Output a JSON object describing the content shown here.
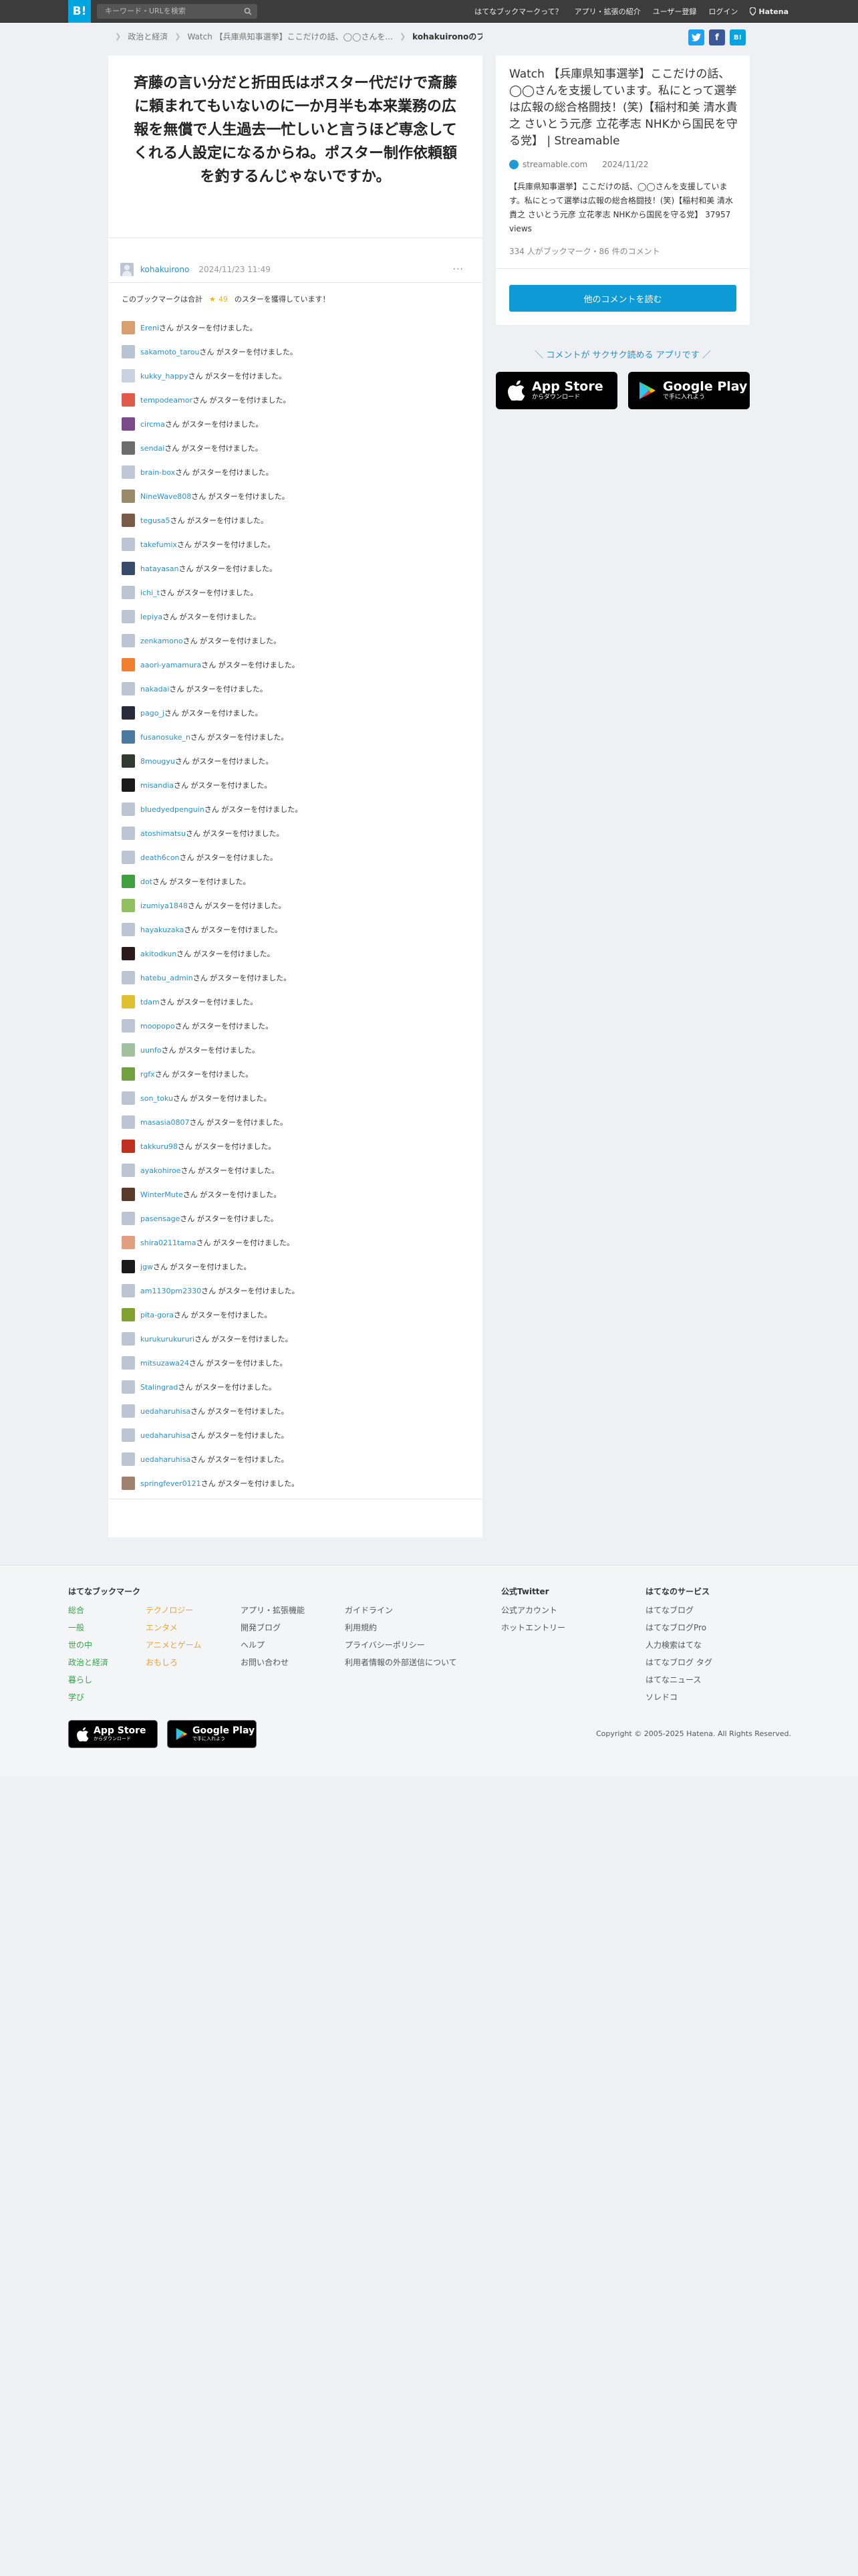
{
  "topbar": {
    "logo": "B!",
    "search_placeholder": "キーワード・URLを検索",
    "nav": [
      "はてなブックマークって？",
      "アプリ・拡張の紹介",
      "ユーザー登録",
      "ログイン"
    ],
    "brand": "Hatena"
  },
  "breadcrumb": {
    "items": [
      "政治と経済",
      "Watch 【兵庫県知事選挙】ここだけの話、◯◯さんを...",
      "kohakuironoのブック..."
    ]
  },
  "share": {
    "twitter": "t",
    "facebook": "f",
    "hatebu": "B!"
  },
  "colors": {
    "accent": "#00a4de",
    "link": "#2c8fc8",
    "star": "#f2b705",
    "twitter": "#1da1f2",
    "facebook": "#3b5998"
  },
  "bookmark": {
    "comment": "斉藤の言い分だと折田氏はポスター代だけで斎藤に頼まれてもいないのに一か月半も本来業務の広報を無償で人生過去一忙しいと言うほど専念してくれる人設定になるからね。ポスター制作依頼額を釣するんじゃないですか。",
    "user": "kohakuirono",
    "date": "2024/11/23 11:49",
    "more": "···"
  },
  "stars": {
    "prefix": "このブックマークは合計",
    "star_glyph": "★",
    "count": "49",
    "suffix": "のスターを獲得しています！",
    "line_suffix": "さん がスターを付けました。",
    "users": [
      "Ereni",
      "sakamoto_tarou",
      "kukky_happy",
      "tempodeamor",
      "circma",
      "sendai",
      "brain-box",
      "NineWave808",
      "tegusa5",
      "takefumix",
      "hatayasan",
      "ichi_t",
      "lepiya",
      "zenkamono",
      "aaori-yamamura",
      "nakadai",
      "pago_j",
      "fusanosuke_n",
      "8mougyu",
      "misandia",
      "bluedyedpenguin",
      "atoshimatsu",
      "death6con",
      "dot",
      "izumiya1848",
      "hayakuzaka",
      "akitodkun",
      "hatebu_admin",
      "tdam",
      "moopopo",
      "uunfo",
      "rgfx",
      "son_toku",
      "masasia0807",
      "takkuru98",
      "ayakohiroe",
      "WinterMute",
      "pasensage",
      "shira0211tama",
      "jgw",
      "am1130pm2330",
      "pita-gora",
      "kurukurukururi",
      "mitsuzawa24",
      "Stalingrad",
      "uedaharuhisa",
      "uedaharuhisa",
      "uedaharuhisa",
      "springfever0121"
    ],
    "avatar_colors": [
      "#d8a070",
      "#b8c4d4",
      "#c9d2de",
      "#e05a4a",
      "#7a4a8a",
      "#6c6c6c",
      "#c0c8d6",
      "#9a8a6a",
      "#7a5a4a",
      "#bcc6d3",
      "#3a4a6a",
      "#bcc6d3",
      "#bcc6d3",
      "#bcc6d3",
      "#f08030",
      "#bcc6d3",
      "#2a2a3a",
      "#4a7aa0",
      "#303a30",
      "#1a1a1a",
      "#bcc6d3",
      "#bcc6d3",
      "#bcc6d3",
      "#40a040",
      "#90c060",
      "#bcc6d3",
      "#2a1a1a",
      "#bcc6d3",
      "#e0c030",
      "#bcc6d3",
      "#a0c0a0",
      "#70a040",
      "#bcc6d3",
      "#bcc6d3",
      "#c03020",
      "#bcc6d3",
      "#5a3a2a",
      "#bcc6d3",
      "#e0a080",
      "#1a1a1a",
      "#bcc6d3",
      "#80a030",
      "#bcc6d3",
      "#bcc6d3",
      "#bcc6d3",
      "#bcc6d3",
      "#bcc6d3",
      "#bcc6d3",
      "#a08070"
    ]
  },
  "entry": {
    "title": "Watch 【兵庫県知事選挙】ここだけの話、◯◯さんを支援しています。私にとって選挙は広報の総合格闘技！(笑)【稲村和美 清水貴之 さいとう元彦 立花孝志 NHKから国民を守る党】 | Streamable",
    "domain": "streamable.com",
    "date": "2024/11/22",
    "description": "【兵庫県知事選挙】ここだけの話、◯◯さんを支援しています。私にとって選挙は広報の総合格闘技！(笑)【稲村和美 清水貴之 さいとう元彦 立花孝志 NHKから国民を守る党】 37957 views",
    "meta": "334 人がブックマーク・86 件のコメント",
    "button": "他のコメントを読む"
  },
  "app": {
    "tagline": "＼ コメントが サクサク読める アプリです ／",
    "appstore_big": "App Store",
    "appstore_small": "からダウンロード",
    "googleplay_big": "Google Play",
    "googleplay_small": "で手に入れよう"
  },
  "footer": {
    "col1_title": "はてなブックマーク",
    "col1a": [
      "総合",
      "一般",
      "世の中",
      "政治と経済",
      "暮らし",
      "学び"
    ],
    "col1b": [
      "テクノロジー",
      "エンタメ",
      "アニメとゲーム",
      "おもしろ"
    ],
    "col2": [
      "アプリ・拡張機能",
      "開発ブログ",
      "ヘルプ",
      "お問い合わせ"
    ],
    "col3": [
      "ガイドライン",
      "利用規約",
      "プライバシーポリシー",
      "利用者情報の外部送信について"
    ],
    "twitter_title": "公式Twitter",
    "twitter": [
      "公式アカウント",
      "ホットエントリー"
    ],
    "services_title": "はてなのサービス",
    "services": [
      "はてなブログ",
      "はてなブログPro",
      "人力検索はてな",
      "はてなブログ タグ",
      "はてなニュース",
      "ソレドコ"
    ],
    "copyright": "Copyright © 2005-2025 Hatena. All Rights Reserved."
  }
}
